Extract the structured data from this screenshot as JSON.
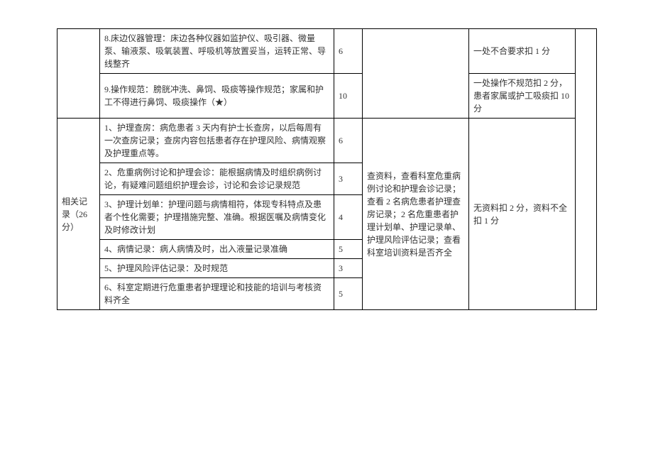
{
  "section1": {
    "row8": {
      "item": "8.床边仪器管理：床边各种仪器如监护仪、吸引器、微量泵、输液泵、吸氧装置、呼吸机等放置妥当，运转正常、导线整齐",
      "score": "6",
      "deduct": "一处不合要求扣 1 分"
    },
    "row9": {
      "item": "9.操作规范：膀胱冲洗、鼻饲、吸痰等操作规范；家属和护工不得进行鼻饲、吸痰操作（★）",
      "score": "10",
      "deduct": "一处操作不规范扣 2 分，患者家属或护工吸痰扣 10 分"
    }
  },
  "section2": {
    "category": "相关记录（26 分）",
    "method": "查资料，查看科室危重病例讨论和护理会诊记录；查看 2 名病危患者护理查房记录；2 名危重患者护理计划单、护理记录单、护理风险评估记录；查看科室培训资料是否齐全",
    "deduct": "无资料扣 2 分，资料不全扣 1 分",
    "rows": [
      {
        "item": "1、护理查房：病危患者 3 天内有护士长查房，以后每周有一次查房记录；查房内容包括患者存在护理风险、病情观察及护理重点等。",
        "score": "6"
      },
      {
        "item": "2、危重病例讨论和护理会诊：能根据病情及时组织病例讨论，有疑难问题组织护理会诊，讨论和会诊记录规范",
        "score": "3"
      },
      {
        "item": "3、护理计划单：护理问题与病情相符，体现专科特点及患者个性化需要；护理措施完整、准确。根据医嘱及病情变化及时修改计划",
        "score": "4"
      },
      {
        "item": "4、病情记录：病人病情及时，出入液量记录准确",
        "score": "5"
      },
      {
        "item": "5、护理风险评估记录：及时规范",
        "score": "3"
      },
      {
        "item": "6、科室定期进行危重患者护理理论和技能的培训与考核资料齐全",
        "score": "5"
      }
    ]
  }
}
